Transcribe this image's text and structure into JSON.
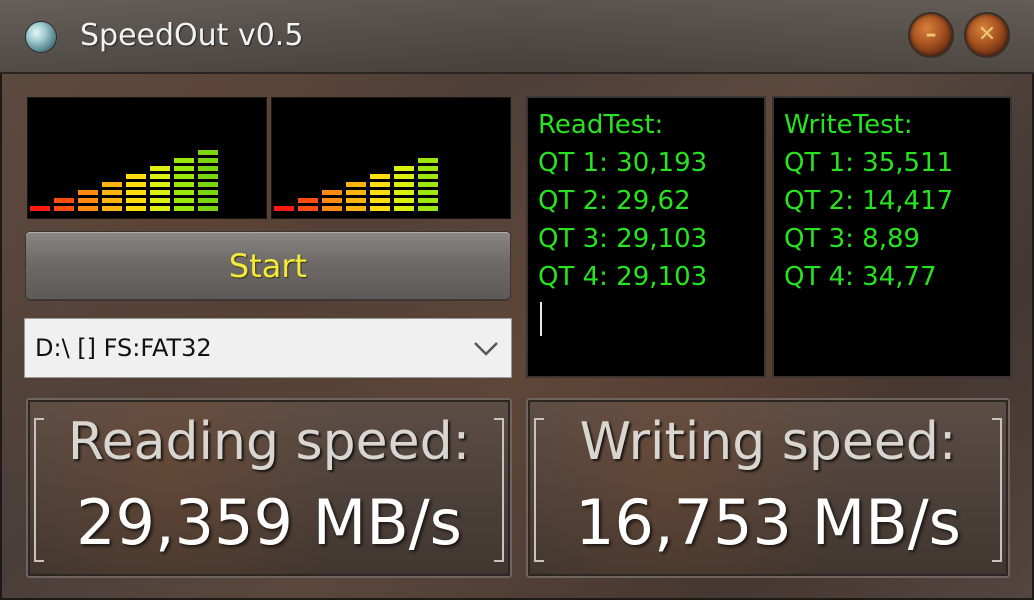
{
  "window": {
    "title": "SpeedOut v0.5"
  },
  "controls": {
    "minimize_icon": "minimize-icon",
    "close_icon": "close-icon",
    "start_label": "Start",
    "drive_value": "D:\\ [] FS:FAT32"
  },
  "meters": {
    "read_level_bars": 8,
    "write_level_bars": 7,
    "colors": [
      "#ff1a12",
      "#ff4d12",
      "#ff8a12",
      "#ffb412",
      "#ffdd10",
      "#dbf00e",
      "#9be60d",
      "#7cd40d"
    ]
  },
  "read_test": {
    "heading": "ReadTest:",
    "lines": [
      "QT 1: 30,193",
      "QT 2: 29,62",
      "QT 3: 29,103",
      "QT 4: 29,103"
    ]
  },
  "write_test": {
    "heading": "WriteTest:",
    "lines": [
      "QT 1: 35,511",
      "QT 2: 14,417",
      "QT 3: 8,89",
      "QT 4: 34,77"
    ]
  },
  "reading": {
    "label": "Reading speed:",
    "value": "29,359 MB/s"
  },
  "writing": {
    "label": "Writing speed:",
    "value": "16,753 MB/s"
  },
  "colors": {
    "log_text": "#26e51f",
    "start_text": "#f4ea3c"
  }
}
